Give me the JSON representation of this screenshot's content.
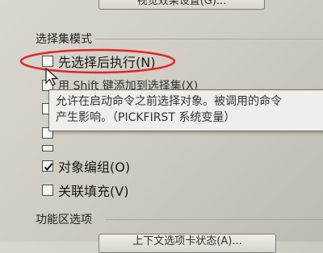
{
  "top_button": {
    "label": "视觉效果设置(G)..."
  },
  "selection_mode": {
    "title": "选择集模式",
    "options": [
      {
        "label": "先选择后执行(N)",
        "checked": false
      },
      {
        "label": "用 Shift 键添加到选择集(X)",
        "checked": false
      },
      {
        "label": "",
        "checked": false
      },
      {
        "label": "",
        "checked": false
      },
      {
        "label": "",
        "checked": false
      },
      {
        "label": "对象编组(O)",
        "checked": true
      },
      {
        "label": "关联填充(V)",
        "checked": false
      }
    ]
  },
  "tooltip": {
    "line1": "允许在启动命令之前选择对象。被调用的命令",
    "line2": "产生影响。（PICKFIRST 系统变量）"
  },
  "ribbon_options": {
    "title": "功能区选项",
    "button_label": "上下文选项卡状态(A)..."
  },
  "colors": {
    "annotation_red": "#e0262a"
  }
}
